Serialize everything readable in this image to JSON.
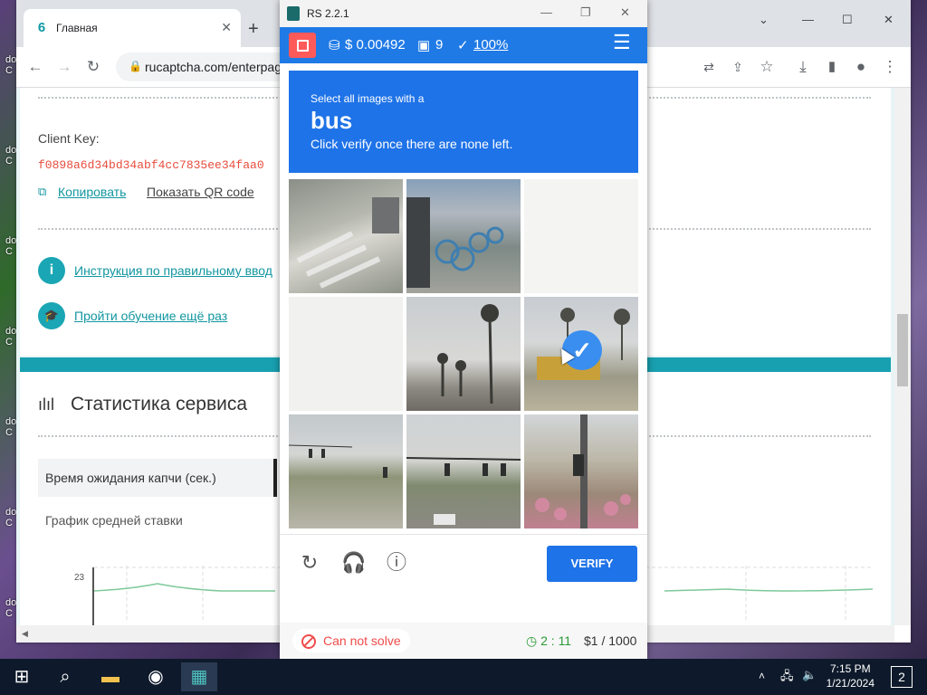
{
  "desktop": {
    "icon_labels": [
      "do\nC",
      "do\nC",
      "do\nC",
      "do\nC",
      "do\nC",
      "do\nC",
      "do\nC"
    ]
  },
  "browser": {
    "tab_title": "Главная",
    "url": "rucaptcha.com/enterpag",
    "page": {
      "client_key_label": "Client Key:",
      "client_key_value": "f0898a6d34bd34abf4cc7835ee34faa0",
      "copy_link": "Копировать",
      "qr_link": "Показать QR code",
      "instruction_link": "Инструкция по правильному ввод",
      "training_link": "Пройти обучение ещё раз",
      "stats_title": "Статистика сервиса",
      "wait_time_tab": "Время ожидания капчи (сек.)",
      "avg_rate_label": "График средней ставки",
      "chart_tick": "23"
    }
  },
  "extension": {
    "window_title": "RS 2.2.1",
    "balance": "$ 0.00492",
    "count": "9",
    "accuracy": "100%",
    "captcha": {
      "instruction_top": "Select all images with a",
      "target": "bus",
      "instruction_bottom": "Click verify once there are none left.",
      "verify_label": "VERIFY"
    },
    "cant_solve": "Can not solve",
    "timer": "2 : 11",
    "price": "$1 / 1000"
  },
  "taskbar": {
    "time": "7:15 PM",
    "date": "1/21/2024",
    "notifications": "2"
  }
}
